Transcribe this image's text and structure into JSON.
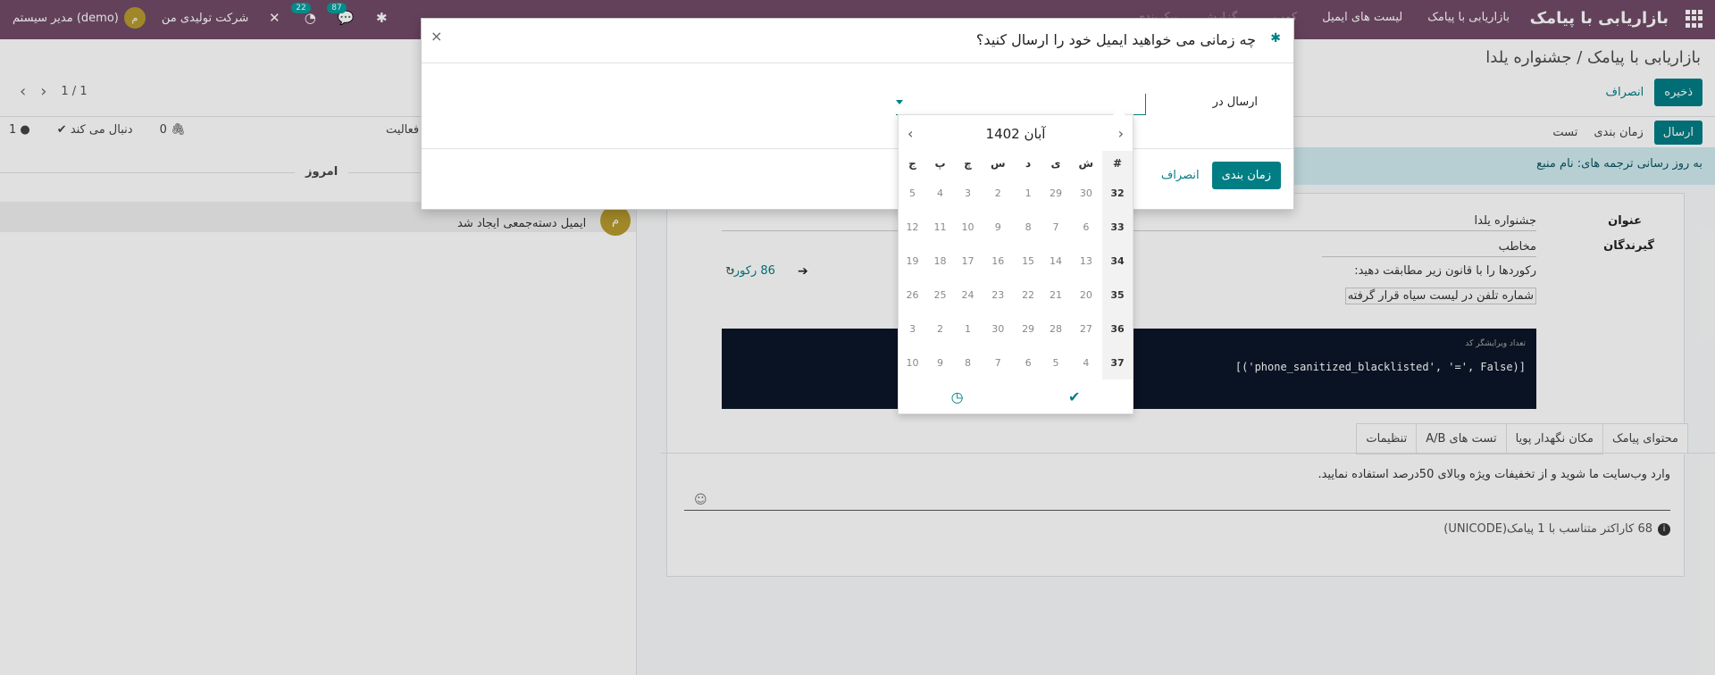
{
  "navbar": {
    "brand": "بازاریابی با پیامک",
    "menu": [
      "بازاریابی با پیامک",
      "لیست های ایمیل",
      "کمپ...",
      "گزارش",
      "پیکربندی"
    ],
    "company": "شرکت تولیدی من",
    "user": "مدیر سیستم (demo)",
    "user_initial": "م",
    "activity_count": "22",
    "message_count": "87"
  },
  "breadcrumb": "بازاریابی با پیامک / جشنواره یلدا",
  "buttons": {
    "save": "ذخیره",
    "discard": "انصراف"
  },
  "pager": {
    "value": "1 / 1"
  },
  "statusbar": {
    "send": "ارسال",
    "schedule": "زمان بندی",
    "test": "تست"
  },
  "chatter": {
    "activity": "فعالیت",
    "attachments": "0",
    "following": "دنبال می کند",
    "followers": "1",
    "today": "امروز",
    "message": "ایمیل دسته‌جمعی ایجاد شد"
  },
  "banner": "به روز رسانی ترجمه های: نام منبع",
  "form": {
    "title_label": "عنوان",
    "title_value": "جشنواره یلدا",
    "recipients_label": "گیرندگان",
    "recipients_value": "مخاطب",
    "rule_text": "رکوردها را با قانون زیر مطابقت دهید:",
    "rule_value": "شماره تلفن در لیست سیاه قرار گرفته",
    "records": "86 رکورد",
    "code_small": "تعداد ویرایشگر کد",
    "code": "[(phone_sanitized_blacklisted', '=', False')]"
  },
  "tabs": [
    "محتوای پیامک",
    "مکان نگهدار پویا",
    "تست های A/B",
    "تنظیمات"
  ],
  "sms": {
    "text": "وارد وب‌سایت ما شوید و از تخفیفات ویژه وبالای 50درصد استفاده نمایید.",
    "meta": "68 کاراکتر متناسب با 1 پیامک(UNICODE)"
  },
  "modal": {
    "title": "چه زمانی می خواهید ایمیل خود را ارسال کنید؟",
    "send_at_label": "ارسال در",
    "schedule_button": "زمان بندی",
    "cancel_button": "انصراف"
  },
  "datepicker": {
    "month_title": "آبان 1402",
    "weekday_headers": [
      "#",
      "ش",
      "ی",
      "د",
      "س",
      "چ",
      "پ",
      "ج"
    ],
    "rows": [
      [
        "32",
        "30",
        "29",
        "1",
        "2",
        "3",
        "4",
        "5"
      ],
      [
        "33",
        "6",
        "7",
        "8",
        "9",
        "10",
        "11",
        "12"
      ],
      [
        "34",
        "13",
        "14",
        "15",
        "16",
        "17",
        "18",
        "19"
      ],
      [
        "35",
        "20",
        "21",
        "22",
        "23",
        "24",
        "25",
        "26"
      ],
      [
        "36",
        "27",
        "28",
        "29",
        "30",
        "1",
        "2",
        "3"
      ],
      [
        "37",
        "4",
        "5",
        "6",
        "7",
        "8",
        "9",
        "10"
      ]
    ]
  }
}
